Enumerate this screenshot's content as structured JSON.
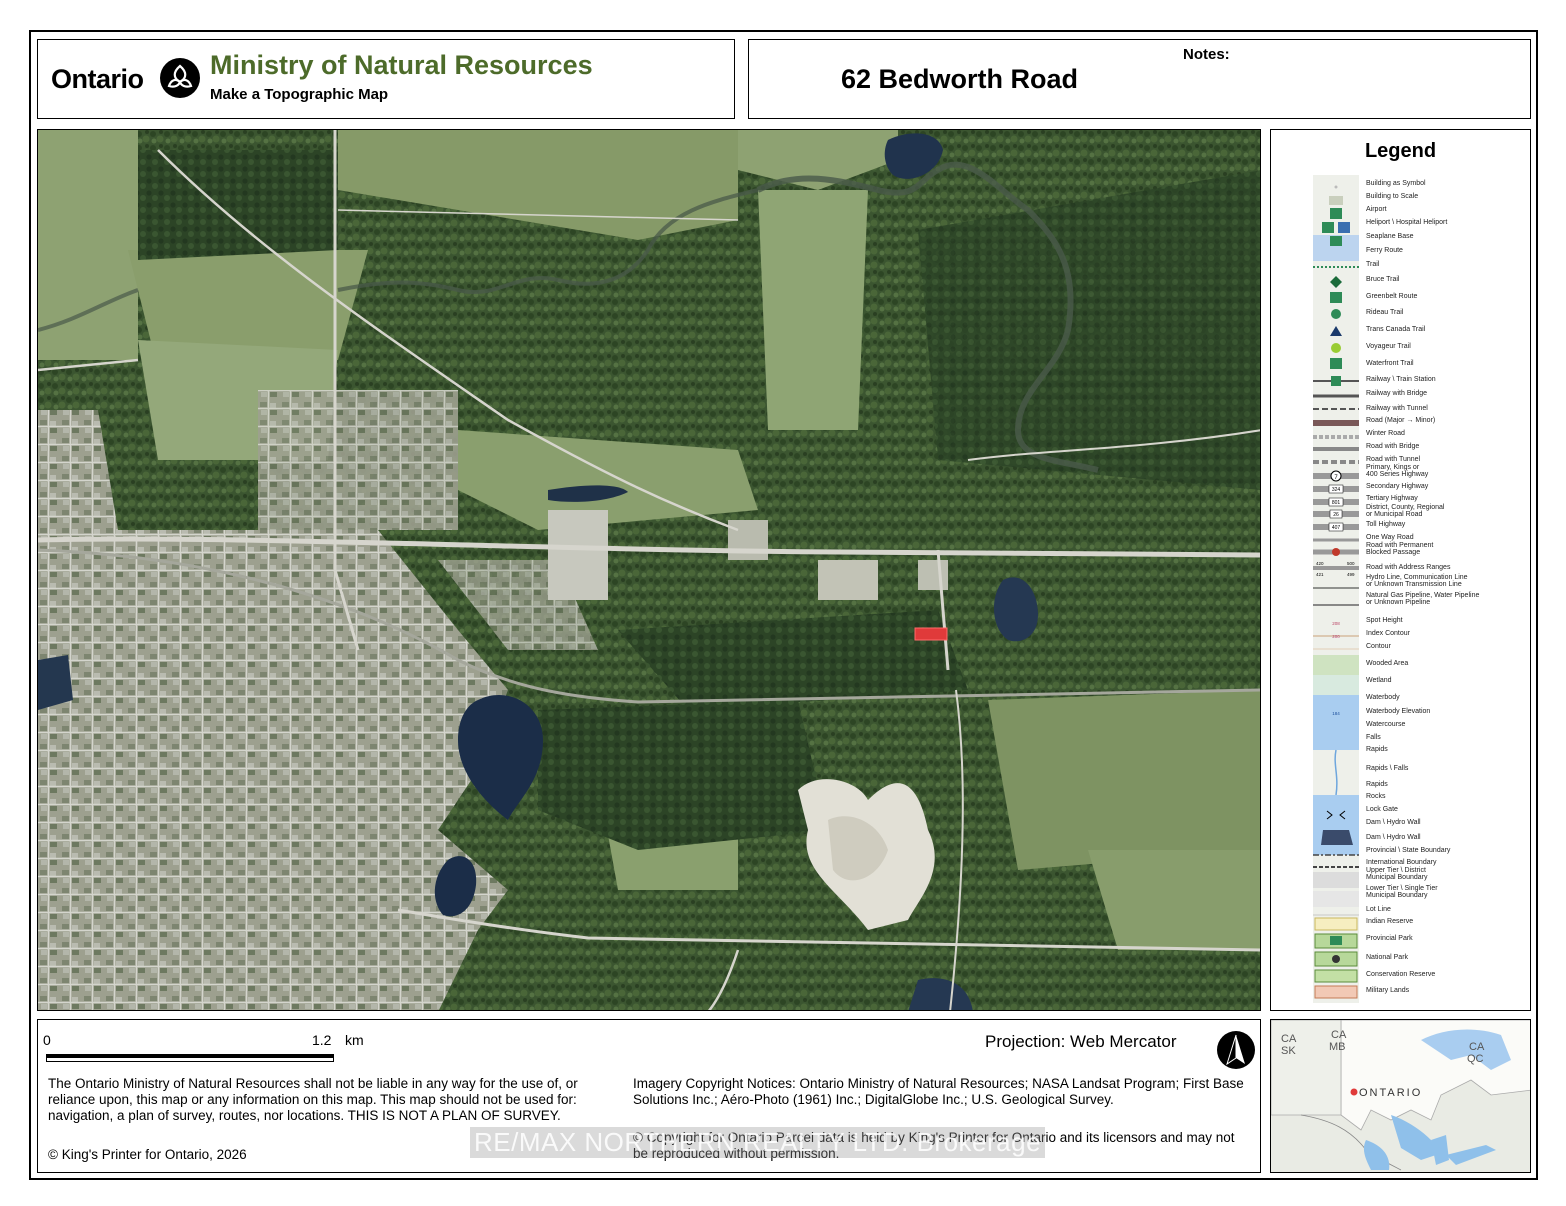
{
  "header": {
    "ontario_wordmark": "Ontario",
    "ministry_name": "Ministry of Natural Resources",
    "subtitle": "Make a Topographic Map",
    "address": "62 Bedworth Road",
    "notes_label": "Notes:"
  },
  "colors": {
    "ministry_green": "#4d6b2a",
    "parcel_highlight": "#e03a3a",
    "water": "#1c2f4a",
    "forest": "#34502a",
    "field": "#8fa473",
    "urban": "#a7aa9e"
  },
  "legend": {
    "title": "Legend",
    "items": [
      "Building as Symbol",
      "Building to Scale",
      "Airport",
      "Heliport \\ Hospital Heliport",
      "Seaplane Base",
      "Ferry Route",
      "Trail",
      "Bruce Trail",
      "Greenbelt Route",
      "Rideau Trail",
      "Trans Canada Trail",
      "Voyageur Trail",
      "Waterfront Trail",
      "Railway \\ Train Station",
      "Railway with Bridge",
      "Railway with Tunnel",
      "Road (Major → Minor)",
      "Winter Road",
      "Road with Bridge",
      "Road with Tunnel",
      "Primary, Kings or\n400 Series Highway",
      "Secondary Highway",
      "Tertiary Highway",
      "District, County, Regional\nor Municipal Road",
      "Toll Highway",
      "One Way Road",
      "Road with Permanent\nBlocked Passage",
      "Road with Address Ranges",
      "Hydro Line, Communication Line\nor Unknown Transmission Line",
      "Natural Gas Pipeline, Water Pipeline\nor Unknown Pipeline",
      "Spot Height",
      "Index Contour",
      "Contour",
      "Wooded Area",
      "Wetland",
      "Waterbody",
      "Waterbody Elevation",
      "Watercourse",
      "Falls",
      "Rapids",
      "Rapids \\ Falls",
      "Rapids",
      "Rocks",
      "Lock Gate",
      "Dam \\ Hydro Wall",
      "Dam \\ Hydro Wall",
      "Provincial \\ State Boundary",
      "International Boundary",
      "Upper Tier \\ District\nMunicipal Boundary",
      "Lower Tier \\ Single Tier\nMunicipal Boundary",
      "Lot Line",
      "Indian Reserve",
      "Provincial Park",
      "National Park",
      "Conservation Reserve",
      "Military Lands"
    ]
  },
  "legend_symbols": {
    "highway_shields": [
      "7",
      "324",
      "801",
      "26",
      "407"
    ],
    "address_ranges": [
      "420",
      "500",
      "421",
      "499"
    ],
    "spot_height": "208",
    "index_contour": "200",
    "waterbody_elevation": "184"
  },
  "footer": {
    "scale_zero": "0",
    "scale_max": "1.2",
    "scale_unit": "km",
    "projection": "Projection: Web Mercator",
    "disclaimer": "The Ontario Ministry of Natural Resources shall not be liable in any way for the use of, or reliance upon, this map or any information on this map.  This map should not be used for: navigation, a plan of survey, routes, nor locations. THIS IS NOT A PLAN OF SURVEY.",
    "kings_printer": "© King's Printer for Ontario,  2026",
    "imagery_notice": "Imagery Copyright Notices: Ontario Ministry of Natural Resources; NASA Landsat Program; First Base Solutions Inc.; Aéro-Photo (1961) Inc.; DigitalGlobe Inc.; U.S. Geological Survey.",
    "parcel_notice": "© Copyright for Ontario Parcel data is held by King's Printer for Ontario and its licensors and may not be reproduced without permission.",
    "watermark": "RE/MAX NORTHERN REALTY LTD. Brokerage"
  },
  "inset": {
    "labels": [
      "CA",
      "SK",
      "CA",
      "MB",
      "CA",
      "QC"
    ],
    "province": "ONTARIO"
  }
}
